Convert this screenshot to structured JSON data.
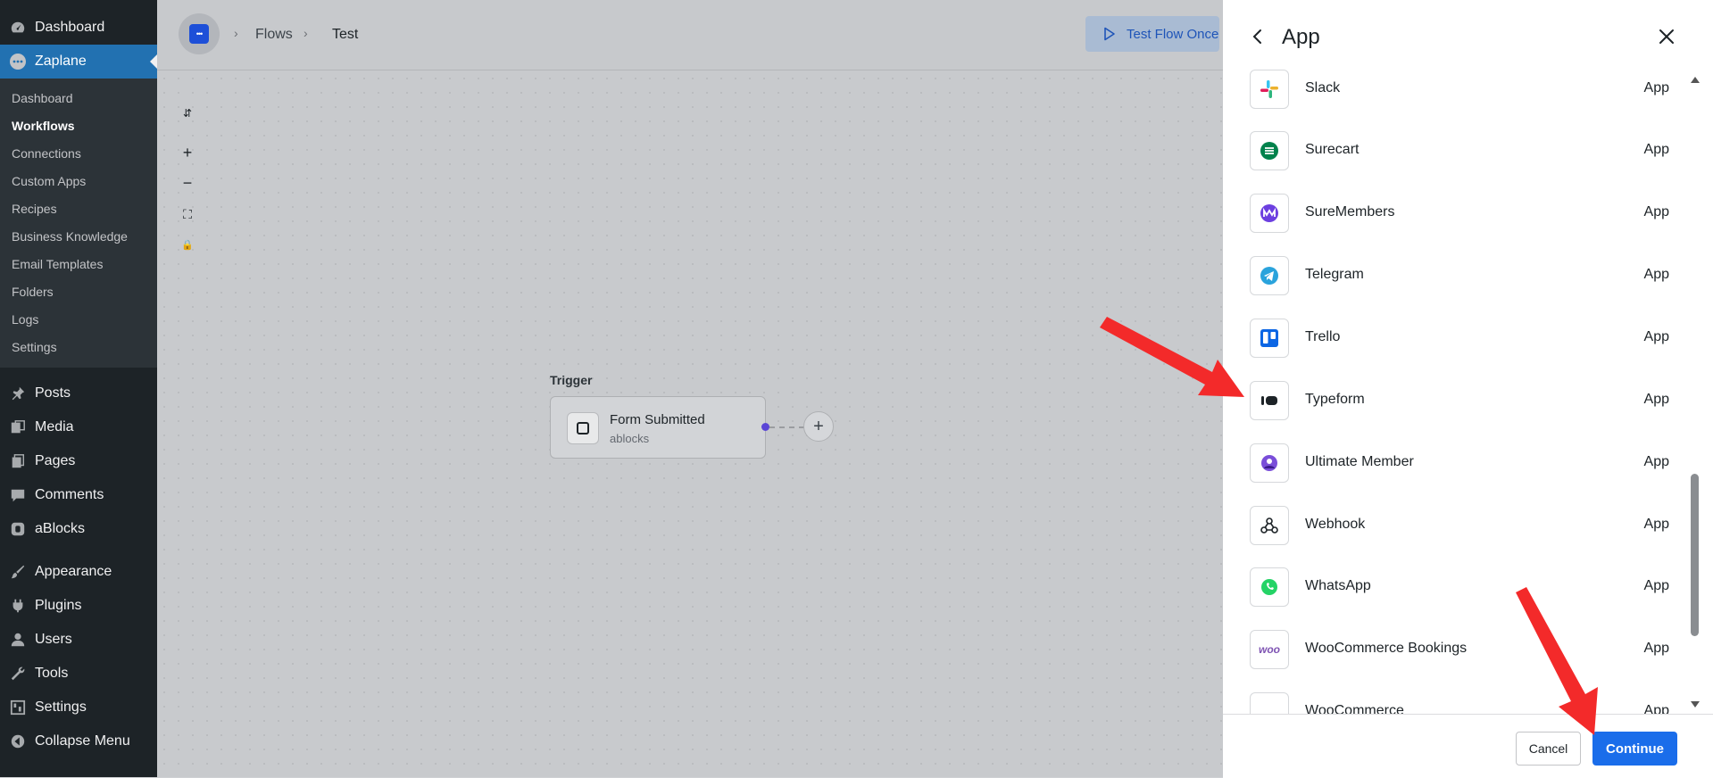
{
  "sidebar": {
    "top": [
      {
        "label": "Dashboard",
        "icon": "dashboard-icon"
      },
      {
        "label": "Zaplane",
        "icon": "zaplane-icon",
        "active": true
      }
    ],
    "submenu": [
      "Dashboard",
      "Workflows",
      "Connections",
      "Custom Apps",
      "Recipes",
      "Business Knowledge",
      "Email Templates",
      "Folders",
      "Logs",
      "Settings"
    ],
    "current_sub": "Workflows",
    "items": [
      {
        "label": "Posts",
        "icon": "pin-icon"
      },
      {
        "label": "Media",
        "icon": "media-icon"
      },
      {
        "label": "Pages",
        "icon": "pages-icon"
      },
      {
        "label": "Comments",
        "icon": "comment-icon"
      },
      {
        "label": "aBlocks",
        "icon": "ablocks-icon"
      },
      {
        "label": "Appearance",
        "icon": "paintbrush-icon"
      },
      {
        "label": "Plugins",
        "icon": "plugin-icon"
      },
      {
        "label": "Users",
        "icon": "user-icon"
      },
      {
        "label": "Tools",
        "icon": "wrench-icon"
      },
      {
        "label": "Settings",
        "icon": "settings-icon"
      },
      {
        "label": "Collapse Menu",
        "icon": "collapse-icon"
      }
    ]
  },
  "header": {
    "logo_text": "•••",
    "breadcrumbs": [
      "Flows",
      "Test"
    ],
    "test_flow_label": "Test Flow Once"
  },
  "canvas": {
    "tools": [
      "⇵",
      "+",
      "−",
      "⛶",
      "🔒"
    ],
    "trigger_label": "Trigger",
    "node": {
      "title": "Form Submitted",
      "subtitle": "ablocks"
    },
    "add_symbol": "+"
  },
  "panel": {
    "title": "App",
    "apps": [
      {
        "name": "Slack",
        "type": "App",
        "icon": "slack-icon"
      },
      {
        "name": "Surecart",
        "type": "App",
        "icon": "surecart-icon"
      },
      {
        "name": "SureMembers",
        "type": "App",
        "icon": "suremembers-icon"
      },
      {
        "name": "Telegram",
        "type": "App",
        "icon": "telegram-icon"
      },
      {
        "name": "Trello",
        "type": "App",
        "icon": "trello-icon"
      },
      {
        "name": "Typeform",
        "type": "App",
        "icon": "typeform-icon"
      },
      {
        "name": "Ultimate Member",
        "type": "App",
        "icon": "ultimate-member-icon"
      },
      {
        "name": "Webhook",
        "type": "App",
        "icon": "webhook-icon"
      },
      {
        "name": "WhatsApp",
        "type": "App",
        "icon": "whatsapp-icon"
      },
      {
        "name": "WooCommerce Bookings",
        "type": "App",
        "icon": "woo-icon"
      },
      {
        "name": "WooCommerce",
        "type": "App",
        "icon": "woo-icon"
      }
    ],
    "cancel_label": "Cancel",
    "continue_label": "Continue"
  },
  "colors": {
    "accent": "#1a6dea",
    "sidebar_bg": "#1d2327",
    "active_menu": "#2271b1",
    "annotation_arrow": "#f32a2a"
  }
}
